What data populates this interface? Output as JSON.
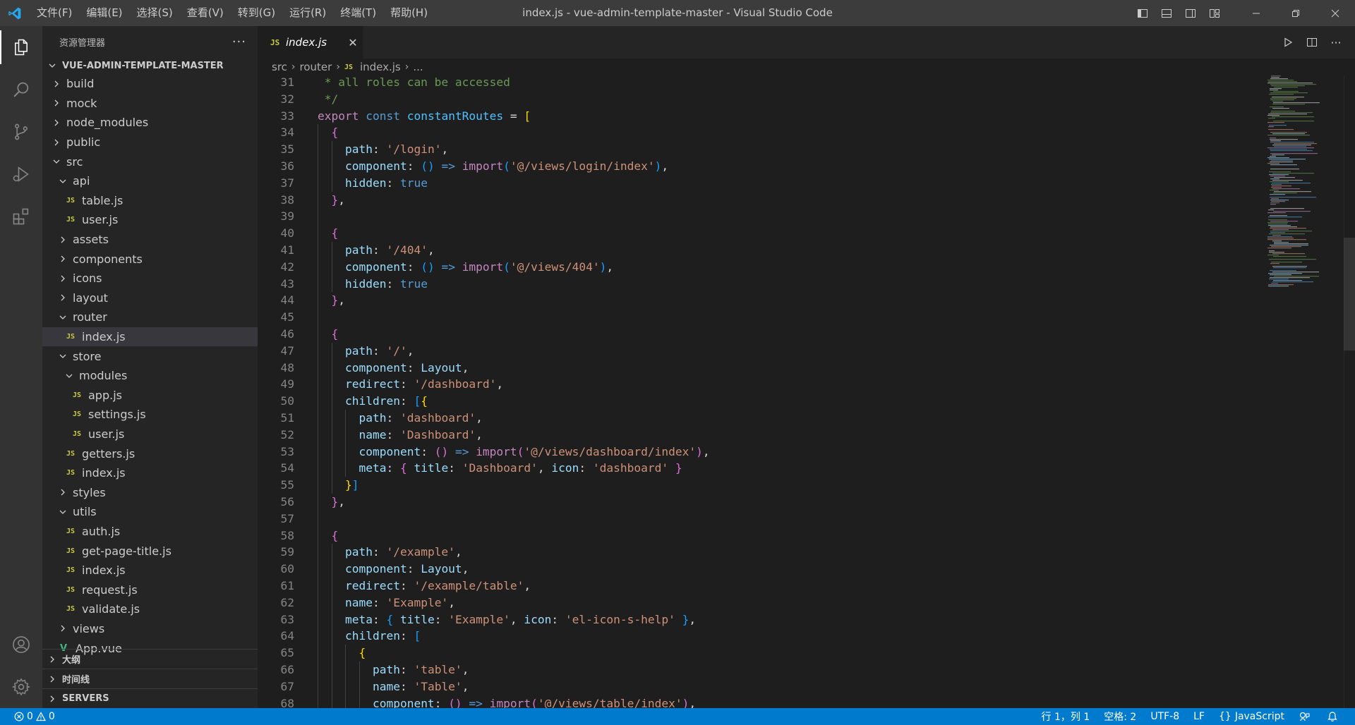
{
  "titlebar": {
    "window_title": "index.js - vue-admin-template-master - Visual Studio Code",
    "menu": [
      "文件(F)",
      "编辑(E)",
      "选择(S)",
      "查看(V)",
      "转到(G)",
      "运行(R)",
      "终端(T)",
      "帮助(H)"
    ],
    "accent": "#3c3c3c"
  },
  "sidebar": {
    "title": "资源管理器",
    "root": "VUE-ADMIN-TEMPLATE-MASTER",
    "tree": [
      {
        "label": "build",
        "type": "folder",
        "expanded": false,
        "depth": 1
      },
      {
        "label": "mock",
        "type": "folder",
        "expanded": false,
        "depth": 1
      },
      {
        "label": "node_modules",
        "type": "folder",
        "expanded": false,
        "depth": 1
      },
      {
        "label": "public",
        "type": "folder",
        "expanded": false,
        "depth": 1
      },
      {
        "label": "src",
        "type": "folder",
        "expanded": true,
        "depth": 1
      },
      {
        "label": "api",
        "type": "folder",
        "expanded": true,
        "depth": 2
      },
      {
        "label": "table.js",
        "type": "js",
        "depth": 3
      },
      {
        "label": "user.js",
        "type": "js",
        "depth": 3
      },
      {
        "label": "assets",
        "type": "folder",
        "expanded": false,
        "depth": 2
      },
      {
        "label": "components",
        "type": "folder",
        "expanded": false,
        "depth": 2
      },
      {
        "label": "icons",
        "type": "folder",
        "expanded": false,
        "depth": 2
      },
      {
        "label": "layout",
        "type": "folder",
        "expanded": false,
        "depth": 2
      },
      {
        "label": "router",
        "type": "folder",
        "expanded": true,
        "depth": 2
      },
      {
        "label": "index.js",
        "type": "js",
        "depth": 3,
        "selected": true
      },
      {
        "label": "store",
        "type": "folder",
        "expanded": true,
        "depth": 2
      },
      {
        "label": "modules",
        "type": "folder",
        "expanded": true,
        "depth": 3
      },
      {
        "label": "app.js",
        "type": "js",
        "depth": 4
      },
      {
        "label": "settings.js",
        "type": "js",
        "depth": 4
      },
      {
        "label": "user.js",
        "type": "js",
        "depth": 4
      },
      {
        "label": "getters.js",
        "type": "js",
        "depth": 3
      },
      {
        "label": "index.js",
        "type": "js",
        "depth": 3
      },
      {
        "label": "styles",
        "type": "folder",
        "expanded": false,
        "depth": 2
      },
      {
        "label": "utils",
        "type": "folder",
        "expanded": true,
        "depth": 2
      },
      {
        "label": "auth.js",
        "type": "js",
        "depth": 3
      },
      {
        "label": "get-page-title.js",
        "type": "js",
        "depth": 3
      },
      {
        "label": "index.js",
        "type": "js",
        "depth": 3
      },
      {
        "label": "request.js",
        "type": "js",
        "depth": 3
      },
      {
        "label": "validate.js",
        "type": "js",
        "depth": 3
      },
      {
        "label": "views",
        "type": "folder",
        "expanded": false,
        "depth": 2
      },
      {
        "label": "App.vue",
        "type": "vue",
        "depth": 2
      }
    ],
    "panes": [
      "大纲",
      "时间线",
      "SERVERS"
    ]
  },
  "editor": {
    "tab_badge": "JS",
    "tab_label": "index.js",
    "breadcrumb": {
      "part1": "src",
      "part2": "router",
      "badge": "JS",
      "file": "index.js",
      "tail": "..."
    },
    "lines": [
      {
        "n": 31,
        "ind": 0,
        "t": [
          [
            " * all roles can be accessed",
            "cm"
          ]
        ]
      },
      {
        "n": 32,
        "ind": 0,
        "t": [
          [
            " */",
            "cm"
          ]
        ]
      },
      {
        "n": 33,
        "ind": 0,
        "t": [
          [
            "export",
            "ctl"
          ],
          [
            " ",
            "p"
          ],
          [
            "const",
            "kw"
          ],
          [
            " ",
            "p"
          ],
          [
            "constantRoutes",
            "var"
          ],
          [
            " = ",
            "p"
          ],
          [
            "[",
            "br1"
          ]
        ]
      },
      {
        "n": 34,
        "ind": 1,
        "t": [
          [
            "  ",
            "p"
          ],
          [
            "{",
            "br2"
          ]
        ]
      },
      {
        "n": 35,
        "ind": 2,
        "t": [
          [
            "    ",
            "p"
          ],
          [
            "path",
            "prop"
          ],
          [
            ": ",
            "p"
          ],
          [
            "'/login'",
            "str"
          ],
          [
            ",",
            "p"
          ]
        ]
      },
      {
        "n": 36,
        "ind": 2,
        "t": [
          [
            "    ",
            "p"
          ],
          [
            "component",
            "prop"
          ],
          [
            ": ",
            "p"
          ],
          [
            "()",
            "br3"
          ],
          [
            " => ",
            "kw"
          ],
          [
            "import",
            "ctl"
          ],
          [
            "(",
            "br3"
          ],
          [
            "'@/views/login/index'",
            "str"
          ],
          [
            ")",
            "br3"
          ],
          [
            ",",
            "p"
          ]
        ]
      },
      {
        "n": 37,
        "ind": 2,
        "t": [
          [
            "    ",
            "p"
          ],
          [
            "hidden",
            "prop"
          ],
          [
            ": ",
            "p"
          ],
          [
            "true",
            "kw"
          ]
        ]
      },
      {
        "n": 38,
        "ind": 1,
        "t": [
          [
            "  ",
            "p"
          ],
          [
            "}",
            "br2"
          ],
          [
            ",",
            "p"
          ]
        ]
      },
      {
        "n": 39,
        "ind": 1,
        "t": []
      },
      {
        "n": 40,
        "ind": 1,
        "t": [
          [
            "  ",
            "p"
          ],
          [
            "{",
            "br2"
          ]
        ]
      },
      {
        "n": 41,
        "ind": 2,
        "t": [
          [
            "    ",
            "p"
          ],
          [
            "path",
            "prop"
          ],
          [
            ": ",
            "p"
          ],
          [
            "'/404'",
            "str"
          ],
          [
            ",",
            "p"
          ]
        ]
      },
      {
        "n": 42,
        "ind": 2,
        "t": [
          [
            "    ",
            "p"
          ],
          [
            "component",
            "prop"
          ],
          [
            ": ",
            "p"
          ],
          [
            "()",
            "br3"
          ],
          [
            " => ",
            "kw"
          ],
          [
            "import",
            "ctl"
          ],
          [
            "(",
            "br3"
          ],
          [
            "'@/views/404'",
            "str"
          ],
          [
            ")",
            "br3"
          ],
          [
            ",",
            "p"
          ]
        ]
      },
      {
        "n": 43,
        "ind": 2,
        "t": [
          [
            "    ",
            "p"
          ],
          [
            "hidden",
            "prop"
          ],
          [
            ": ",
            "p"
          ],
          [
            "true",
            "kw"
          ]
        ]
      },
      {
        "n": 44,
        "ind": 1,
        "t": [
          [
            "  ",
            "p"
          ],
          [
            "}",
            "br2"
          ],
          [
            ",",
            "p"
          ]
        ]
      },
      {
        "n": 45,
        "ind": 1,
        "t": []
      },
      {
        "n": 46,
        "ind": 1,
        "t": [
          [
            "  ",
            "p"
          ],
          [
            "{",
            "br2"
          ]
        ]
      },
      {
        "n": 47,
        "ind": 2,
        "t": [
          [
            "    ",
            "p"
          ],
          [
            "path",
            "prop"
          ],
          [
            ": ",
            "p"
          ],
          [
            "'/'",
            "str"
          ],
          [
            ",",
            "p"
          ]
        ]
      },
      {
        "n": 48,
        "ind": 2,
        "t": [
          [
            "    ",
            "p"
          ],
          [
            "component",
            "prop"
          ],
          [
            ": ",
            "p"
          ],
          [
            "Layout",
            "prop"
          ],
          [
            ",",
            "p"
          ]
        ]
      },
      {
        "n": 49,
        "ind": 2,
        "t": [
          [
            "    ",
            "p"
          ],
          [
            "redirect",
            "prop"
          ],
          [
            ": ",
            "p"
          ],
          [
            "'/dashboard'",
            "str"
          ],
          [
            ",",
            "p"
          ]
        ]
      },
      {
        "n": 50,
        "ind": 2,
        "t": [
          [
            "    ",
            "p"
          ],
          [
            "children",
            "prop"
          ],
          [
            ": ",
            "p"
          ],
          [
            "[",
            "br3"
          ],
          [
            "{",
            "br1"
          ]
        ]
      },
      {
        "n": 51,
        "ind": 3,
        "t": [
          [
            "      ",
            "p"
          ],
          [
            "path",
            "prop"
          ],
          [
            ": ",
            "p"
          ],
          [
            "'dashboard'",
            "str"
          ],
          [
            ",",
            "p"
          ]
        ]
      },
      {
        "n": 52,
        "ind": 3,
        "t": [
          [
            "      ",
            "p"
          ],
          [
            "name",
            "prop"
          ],
          [
            ": ",
            "p"
          ],
          [
            "'Dashboard'",
            "str"
          ],
          [
            ",",
            "p"
          ]
        ]
      },
      {
        "n": 53,
        "ind": 3,
        "t": [
          [
            "      ",
            "p"
          ],
          [
            "component",
            "prop"
          ],
          [
            ": ",
            "p"
          ],
          [
            "()",
            "br2"
          ],
          [
            " => ",
            "kw"
          ],
          [
            "import",
            "ctl"
          ],
          [
            "(",
            "br2"
          ],
          [
            "'@/views/dashboard/index'",
            "str"
          ],
          [
            ")",
            "br2"
          ],
          [
            ",",
            "p"
          ]
        ]
      },
      {
        "n": 54,
        "ind": 3,
        "t": [
          [
            "      ",
            "p"
          ],
          [
            "meta",
            "prop"
          ],
          [
            ": ",
            "p"
          ],
          [
            "{",
            "br2"
          ],
          [
            " ",
            "p"
          ],
          [
            "title",
            "prop"
          ],
          [
            ": ",
            "p"
          ],
          [
            "'Dashboard'",
            "str"
          ],
          [
            ", ",
            "p"
          ],
          [
            "icon",
            "prop"
          ],
          [
            ": ",
            "p"
          ],
          [
            "'dashboard'",
            "str"
          ],
          [
            " ",
            "p"
          ],
          [
            "}",
            "br2"
          ]
        ]
      },
      {
        "n": 55,
        "ind": 2,
        "t": [
          [
            "    ",
            "p"
          ],
          [
            "}",
            "br1"
          ],
          [
            "]",
            "br3"
          ]
        ]
      },
      {
        "n": 56,
        "ind": 1,
        "t": [
          [
            "  ",
            "p"
          ],
          [
            "}",
            "br2"
          ],
          [
            ",",
            "p"
          ]
        ]
      },
      {
        "n": 57,
        "ind": 1,
        "t": []
      },
      {
        "n": 58,
        "ind": 1,
        "t": [
          [
            "  ",
            "p"
          ],
          [
            "{",
            "br2"
          ]
        ]
      },
      {
        "n": 59,
        "ind": 2,
        "t": [
          [
            "    ",
            "p"
          ],
          [
            "path",
            "prop"
          ],
          [
            ": ",
            "p"
          ],
          [
            "'/example'",
            "str"
          ],
          [
            ",",
            "p"
          ]
        ]
      },
      {
        "n": 60,
        "ind": 2,
        "t": [
          [
            "    ",
            "p"
          ],
          [
            "component",
            "prop"
          ],
          [
            ": ",
            "p"
          ],
          [
            "Layout",
            "prop"
          ],
          [
            ",",
            "p"
          ]
        ]
      },
      {
        "n": 61,
        "ind": 2,
        "t": [
          [
            "    ",
            "p"
          ],
          [
            "redirect",
            "prop"
          ],
          [
            ": ",
            "p"
          ],
          [
            "'/example/table'",
            "str"
          ],
          [
            ",",
            "p"
          ]
        ]
      },
      {
        "n": 62,
        "ind": 2,
        "t": [
          [
            "    ",
            "p"
          ],
          [
            "name",
            "prop"
          ],
          [
            ": ",
            "p"
          ],
          [
            "'Example'",
            "str"
          ],
          [
            ",",
            "p"
          ]
        ]
      },
      {
        "n": 63,
        "ind": 2,
        "t": [
          [
            "    ",
            "p"
          ],
          [
            "meta",
            "prop"
          ],
          [
            ": ",
            "p"
          ],
          [
            "{",
            "br3"
          ],
          [
            " ",
            "p"
          ],
          [
            "title",
            "prop"
          ],
          [
            ": ",
            "p"
          ],
          [
            "'Example'",
            "str"
          ],
          [
            ", ",
            "p"
          ],
          [
            "icon",
            "prop"
          ],
          [
            ": ",
            "p"
          ],
          [
            "'el-icon-s-help'",
            "str"
          ],
          [
            " ",
            "p"
          ],
          [
            "}",
            "br3"
          ],
          [
            ",",
            "p"
          ]
        ]
      },
      {
        "n": 64,
        "ind": 2,
        "t": [
          [
            "    ",
            "p"
          ],
          [
            "children",
            "prop"
          ],
          [
            ": ",
            "p"
          ],
          [
            "[",
            "br3"
          ]
        ]
      },
      {
        "n": 65,
        "ind": 3,
        "t": [
          [
            "      ",
            "p"
          ],
          [
            "{",
            "br1"
          ]
        ]
      },
      {
        "n": 66,
        "ind": 4,
        "t": [
          [
            "        ",
            "p"
          ],
          [
            "path",
            "prop"
          ],
          [
            ": ",
            "p"
          ],
          [
            "'table'",
            "str"
          ],
          [
            ",",
            "p"
          ]
        ]
      },
      {
        "n": 67,
        "ind": 4,
        "t": [
          [
            "        ",
            "p"
          ],
          [
            "name",
            "prop"
          ],
          [
            ": ",
            "p"
          ],
          [
            "'Table'",
            "str"
          ],
          [
            ",",
            "p"
          ]
        ]
      },
      {
        "n": 68,
        "ind": 4,
        "t": [
          [
            "        ",
            "p"
          ],
          [
            "component",
            "prop"
          ],
          [
            ": ",
            "p"
          ],
          [
            "()",
            "br2"
          ],
          [
            " => ",
            "kw"
          ],
          [
            "import",
            "ctl"
          ],
          [
            "(",
            "br2"
          ],
          [
            "'@/views/table/index'",
            "str"
          ],
          [
            ")",
            "br2"
          ],
          [
            ",",
            "p"
          ]
        ]
      }
    ]
  },
  "statusbar": {
    "errors": "0",
    "warnings": "0",
    "position": "行 1，列 1",
    "spaces": "空格: 2",
    "encoding": "UTF-8",
    "eol": "LF",
    "language": "JavaScript",
    "color": "#007acc"
  }
}
